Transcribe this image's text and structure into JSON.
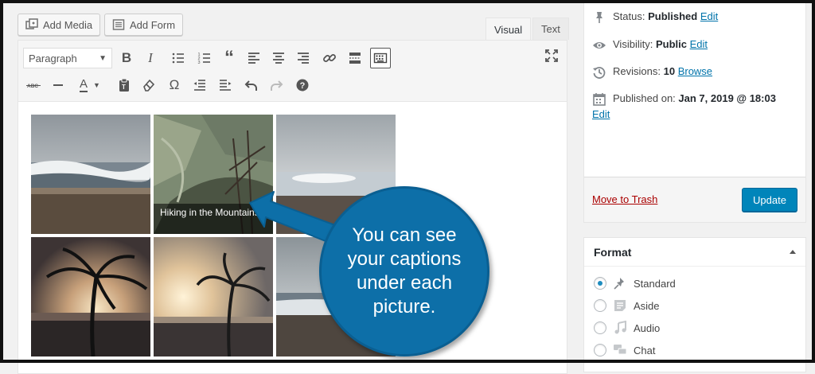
{
  "media_buttons": {
    "add_media": "Add Media",
    "add_form": "Add Form"
  },
  "editor_tabs": {
    "visual": "Visual",
    "text": "Text"
  },
  "toolbar": {
    "format_select": "Paragraph",
    "text_color_letter": "A"
  },
  "gallery": {
    "caption": "Hiking in the Mountains"
  },
  "callout": {
    "text": "You can see your captions under each picture."
  },
  "publish": {
    "status_label": "Status:",
    "status_value": "Published",
    "status_edit": "Edit",
    "visibility_label": "Visibility:",
    "visibility_value": "Public",
    "visibility_edit": "Edit",
    "revisions_label": "Revisions:",
    "revisions_value": "10",
    "revisions_browse": "Browse",
    "published_label": "Published on:",
    "published_value": "Jan 7, 2019 @ 18:03",
    "published_edit": "Edit",
    "trash": "Move to Trash",
    "update": "Update"
  },
  "format": {
    "title": "Format",
    "options": [
      "Standard",
      "Aside",
      "Audio",
      "Chat"
    ],
    "selected": "Standard"
  },
  "colors": {
    "accent": "#0085ba",
    "callout": "#0d6fa8",
    "link": "#0073aa",
    "trash": "#a00"
  }
}
